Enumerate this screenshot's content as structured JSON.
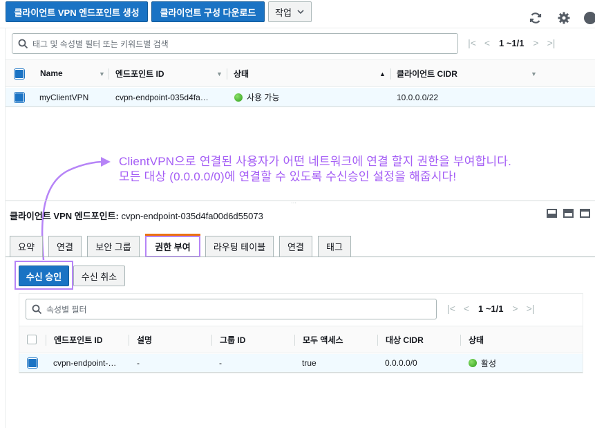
{
  "toolbar": {
    "create_label": "클라이언트 VPN 엔드포인트 생성",
    "download_label": "클라이언트 구성 다운로드",
    "actions_label": "작업"
  },
  "top_table": {
    "search_placeholder": "태그 및 속성별 필터 또는 키워드별 검색",
    "pager_text": "1 ~1/1",
    "columns": [
      "Name",
      "엔드포인트 ID",
      "상태",
      "클라이언트 CIDR"
    ],
    "rows": [
      {
        "name": "myClientVPN",
        "endpoint_id": "cvpn-endpoint-035d4fa…",
        "status": "사용 가능",
        "cidr": "10.0.0.0/22"
      }
    ]
  },
  "annotation": {
    "line1": "ClientVPN으로 연결된 사용자가 어떤 네트워크에 연결 할지 권한을 부여합니다.",
    "line2": "모든 대상 (0.0.0.0/0)에 연결할 수 있도록 수신승인 설정을 해줍시다!",
    "color": "#a45df5"
  },
  "detail": {
    "title_label": "클라이언트 VPN 엔드포인트:",
    "title_value": "cvpn-endpoint-035d4fa00d6d55073",
    "tabs": [
      "요약",
      "연결",
      "보안 그룹",
      "권한 부여",
      "라우팅 테이블",
      "연결",
      "태그"
    ],
    "active_tab": "권한 부여",
    "authorize_label": "수신 승인",
    "revoke_label": "수신 취소"
  },
  "auth_table": {
    "search_placeholder": "속성별 필터",
    "pager_text": "1 ~1/1",
    "columns": [
      "엔드포인트 ID",
      "설명",
      "그룹 ID",
      "모두 액세스",
      "대상 CIDR",
      "상태"
    ],
    "rows": [
      {
        "endpoint_id": "cvpn-endpoint-…",
        "description": "-",
        "group_id": "-",
        "all_access": "true",
        "dest_cidr": "0.0.0.0/0",
        "status": "활성"
      }
    ]
  },
  "colors": {
    "primary": "#1a73c4",
    "highlight": "#a45df5",
    "row_selected": "#f1faff"
  }
}
